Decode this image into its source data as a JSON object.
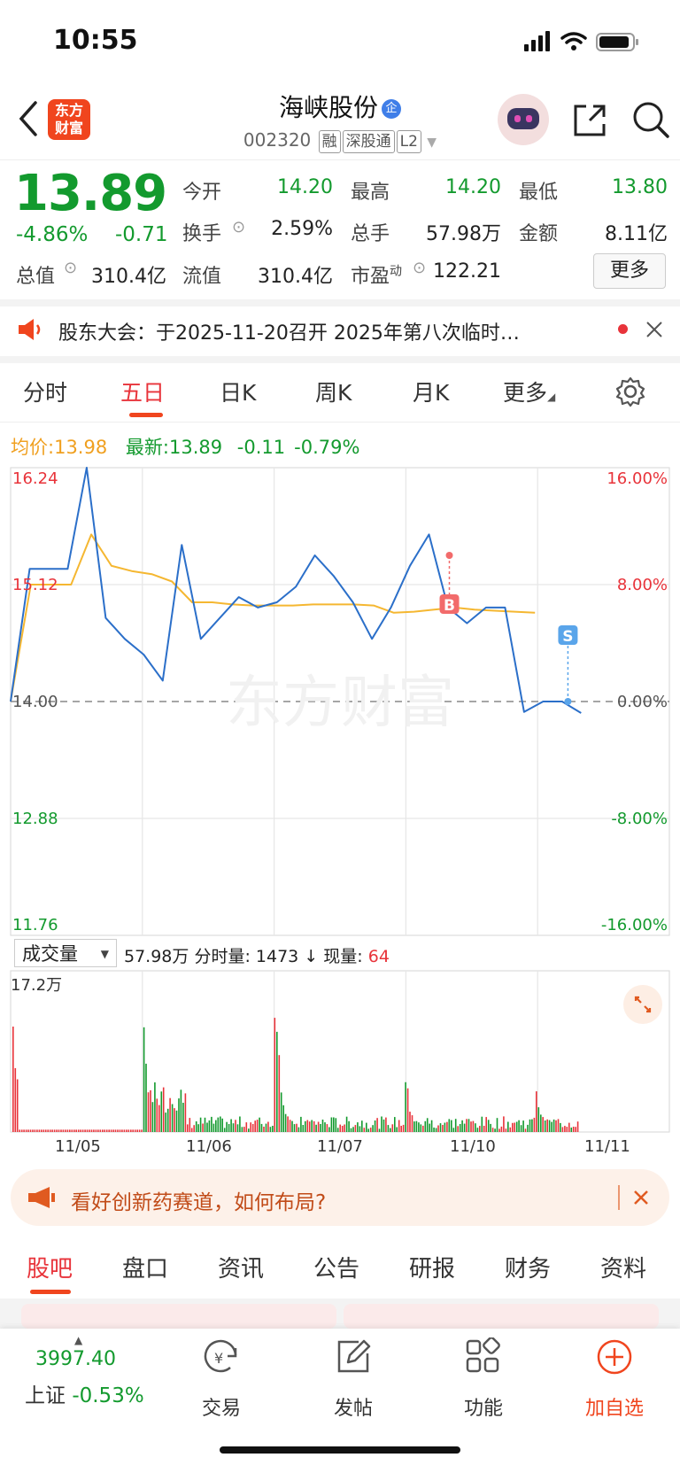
{
  "status": {
    "time": "10:55"
  },
  "header": {
    "logo_line1": "东方",
    "logo_line2": "财富",
    "stock_name": "海峡股份",
    "badge": "企",
    "code": "002320",
    "tags": [
      "融",
      "深股通",
      "L2"
    ]
  },
  "quote": {
    "price": "13.89",
    "change_pct": "-4.86%",
    "change": "-0.71",
    "open_label": "今开",
    "open": "14.20",
    "high_label": "最高",
    "high": "14.20",
    "low_label": "最低",
    "low": "13.80",
    "turnover_label": "换手",
    "turnover": "2.59%",
    "volume_label": "总手",
    "volume": "57.98万",
    "amount_label": "金额",
    "amount": "8.11亿",
    "mcap_label": "总值",
    "mcap": "310.4亿",
    "float_label": "流值",
    "float": "310.4亿",
    "pe_label": "市盈",
    "pe_sup": "动",
    "pe": "122.21",
    "more_label": "更多"
  },
  "notice": {
    "text": "股东大会：于2025-11-20召开 2025年第八次临时…"
  },
  "chart_tabs": {
    "items": [
      "分时",
      "五日",
      "日K",
      "周K",
      "月K",
      "更多"
    ],
    "active": "五日"
  },
  "legend": {
    "avg_label": "均价:",
    "avg_value": "13.98",
    "last_label": "最新:",
    "last_value": "13.89",
    "last_chg": "-0.11",
    "last_pct": "-0.79%"
  },
  "chart_data": {
    "type": "line",
    "x": [
      "11/05",
      "11/06",
      "11/07",
      "11/10",
      "11/11"
    ],
    "y_left_ticks": [
      "16.24",
      "15.12",
      "14.00",
      "12.88",
      "11.76"
    ],
    "y_right_ticks": [
      "16.00%",
      "8.00%",
      "0.00%",
      "-8.00%",
      "-16.00%"
    ],
    "ylim": [
      11.76,
      16.24
    ],
    "series": [
      {
        "values": [
          14.0,
          15.27,
          15.27,
          15.27,
          16.24,
          14.8,
          14.6,
          14.45,
          14.2,
          15.5,
          14.6,
          14.8,
          15.0,
          14.9,
          14.95,
          15.1,
          15.4,
          15.2,
          14.95,
          14.6,
          14.9,
          15.3,
          15.6,
          14.9,
          14.75,
          14.9,
          14.9,
          13.9,
          14.0,
          14.0,
          13.89
        ]
      },
      {
        "values": [
          14.0,
          15.12,
          15.12,
          15.12,
          15.6,
          15.3,
          15.25,
          15.22,
          15.15,
          14.95,
          14.95,
          14.93,
          14.92,
          14.92,
          14.92,
          14.93,
          14.93,
          14.93,
          14.92,
          14.85,
          14.86,
          14.88,
          14.9,
          14.88,
          14.87,
          14.86,
          14.85
        ]
      }
    ],
    "markers": [
      {
        "label": "B",
        "value": 15.4
      },
      {
        "label": "S",
        "value": 14.0
      }
    ],
    "volume": {
      "label": "成交量",
      "total": "57.98万",
      "min_label": "分时量:",
      "min_value": "1473",
      "arrow": "↓",
      "cur_label": "现量:",
      "cur_value": "64",
      "max_tick": "17.2万"
    }
  },
  "banner": {
    "text": "看好创新药赛道，如何布局?"
  },
  "bottom_tabs": {
    "items": [
      "股吧",
      "盘口",
      "资讯",
      "公告",
      "研报",
      "财务",
      "资料"
    ],
    "active": "股吧"
  },
  "nav": {
    "index_value": "3997.40",
    "index_name": "上证",
    "index_pct": "-0.53%",
    "trade": "交易",
    "post": "发帖",
    "func": "功能",
    "add": "加自选"
  }
}
